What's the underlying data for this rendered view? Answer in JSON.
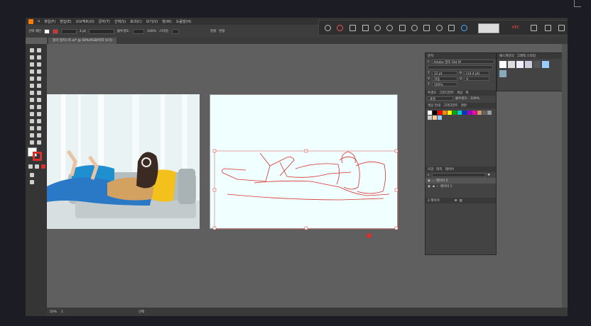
{
  "menubar": {
    "items": [
      "파일(F)",
      "편집(E)",
      "오브젝트(O)",
      "문자(T)",
      "선택(S)",
      "효과(C)",
      "보기(V)",
      "창(W)",
      "도움말(H)"
    ]
  },
  "control": {
    "label": "선택 패턴",
    "stroke": "1 pt",
    "opacity_label": "불투명도:",
    "opacity": "100%",
    "style_label": "스타일:",
    "arrange": "정렬",
    "transform": "변형"
  },
  "doc_tab": "종이 일러스트.ai* @ 50%(RGB/미리 보기)",
  "floating": {
    "rec_label": "REC"
  },
  "char_panel": {
    "tab": "문자",
    "search": "Adobe 명조 Std M",
    "size": "12 pt",
    "leading": "(14.4 pt)",
    "tracking": "0",
    "kerning": "자동",
    "scale": "100%"
  },
  "color_panel": {
    "tabs": [
      "투명도",
      "그라디언트",
      "색상",
      "획"
    ],
    "mode": "표준",
    "opacity_label": "불투명도:",
    "opacity": "100%"
  },
  "swatch_panel": {
    "tabs": [
      "색상 안내",
      "그라디언트",
      "견본"
    ]
  },
  "layers_panel": {
    "tabs": [
      "모양",
      "대지",
      "레이어"
    ],
    "layers": [
      "레이어 2",
      "레이어 1"
    ],
    "count": "2 레이어"
  },
  "right_panel": {
    "tabs": [
      "패스파인더",
      "그래픽 스타일"
    ]
  },
  "status": {
    "zoom": "50%",
    "artboard": "1",
    "tool": "선택"
  },
  "colors": {
    "accent": "#ff7c00",
    "stroke": "#d8302c",
    "swatches": [
      "#ffffff",
      "#000000",
      "#ff0000",
      "#ff8800",
      "#ffff00",
      "#00aa00",
      "#00cccc",
      "#0033cc",
      "#9900cc",
      "#ff00aa",
      "#cc9966",
      "#666666",
      "#999999",
      "#cccccc",
      "#ffcc99",
      "#99ccff"
    ]
  }
}
